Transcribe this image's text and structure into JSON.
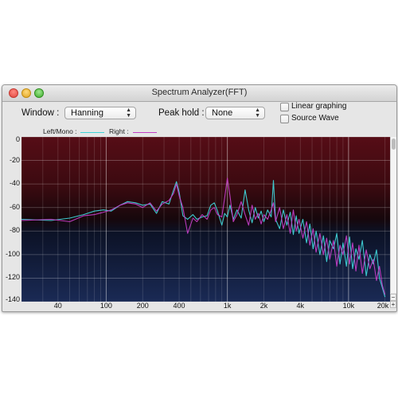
{
  "window": {
    "title": "Spectrum Analyzer(FFT)"
  },
  "controls": {
    "window_label": "Window :",
    "window_value": "Hanning",
    "peak_hold_label": "Peak hold :",
    "peak_hold_value": "None",
    "linear_graphing_label": "Linear graphing",
    "linear_graphing_checked": false,
    "source_wave_label": "Source Wave",
    "source_wave_checked": false
  },
  "legend": {
    "left_label": "Left/Mono :",
    "left_color": "#3fd3d8",
    "right_label": "Right :",
    "right_color": "#c23ec6"
  },
  "scroll": {
    "zoom_in": "+",
    "zoom_out": "−"
  },
  "chart_data": {
    "type": "line",
    "x_scale": "log",
    "xlim": [
      20,
      22000
    ],
    "ylim": [
      -140,
      0
    ],
    "grid": true,
    "x_tick_labels": [
      {
        "value": 40,
        "label": "40"
      },
      {
        "value": 100,
        "label": "100"
      },
      {
        "value": 200,
        "label": "200"
      },
      {
        "value": 400,
        "label": "400"
      },
      {
        "value": 1000,
        "label": "1k"
      },
      {
        "value": 2000,
        "label": "2k"
      },
      {
        "value": 4000,
        "label": "4k"
      },
      {
        "value": 10000,
        "label": "10k"
      },
      {
        "value": 20000,
        "label": "20k"
      }
    ],
    "y_tick_labels": [
      {
        "value": 0,
        "label": "0"
      },
      {
        "value": -20,
        "label": "-20"
      },
      {
        "value": -40,
        "label": "-40"
      },
      {
        "value": -60,
        "label": "-60"
      },
      {
        "value": -80,
        "label": "-80"
      },
      {
        "value": -100,
        "label": "-100"
      },
      {
        "value": -120,
        "label": "-120"
      },
      {
        "value": -140,
        "label": "-140"
      }
    ],
    "series": [
      {
        "name": "Left/Mono :",
        "color": "#3fd3d8",
        "points": [
          [
            20,
            -70
          ],
          [
            35,
            -71
          ],
          [
            50,
            -69
          ],
          [
            65,
            -66
          ],
          [
            80,
            -63
          ],
          [
            95,
            -62
          ],
          [
            110,
            -63
          ],
          [
            130,
            -58
          ],
          [
            150,
            -55
          ],
          [
            175,
            -56
          ],
          [
            200,
            -58
          ],
          [
            230,
            -57
          ],
          [
            260,
            -65
          ],
          [
            290,
            -55
          ],
          [
            330,
            -57
          ],
          [
            360,
            -45
          ],
          [
            380,
            -38
          ],
          [
            400,
            -47
          ],
          [
            430,
            -67
          ],
          [
            470,
            -70
          ],
          [
            520,
            -66
          ],
          [
            560,
            -70
          ],
          [
            620,
            -68
          ],
          [
            680,
            -67
          ],
          [
            730,
            -58
          ],
          [
            780,
            -56
          ],
          [
            830,
            -63
          ],
          [
            900,
            -75
          ],
          [
            950,
            -65
          ],
          [
            1000,
            -68
          ],
          [
            1050,
            -58
          ],
          [
            1120,
            -70
          ],
          [
            1200,
            -62
          ],
          [
            1300,
            -69
          ],
          [
            1400,
            -45
          ],
          [
            1500,
            -62
          ],
          [
            1600,
            -73
          ],
          [
            1700,
            -60
          ],
          [
            1800,
            -69
          ],
          [
            1900,
            -63
          ],
          [
            2000,
            -72
          ],
          [
            2150,
            -62
          ],
          [
            2300,
            -68
          ],
          [
            2400,
            -37
          ],
          [
            2500,
            -70
          ],
          [
            2700,
            -78
          ],
          [
            2900,
            -62
          ],
          [
            3100,
            -75
          ],
          [
            3300,
            -64
          ],
          [
            3500,
            -83
          ],
          [
            3700,
            -67
          ],
          [
            3900,
            -82
          ],
          [
            4200,
            -70
          ],
          [
            4500,
            -90
          ],
          [
            4800,
            -74
          ],
          [
            5100,
            -95
          ],
          [
            5400,
            -80
          ],
          [
            5800,
            -100
          ],
          [
            6200,
            -84
          ],
          [
            6600,
            -106
          ],
          [
            7000,
            -88
          ],
          [
            7500,
            -95
          ],
          [
            8000,
            -82
          ],
          [
            8500,
            -108
          ],
          [
            9000,
            -90
          ],
          [
            9600,
            -110
          ],
          [
            10200,
            -85
          ],
          [
            10800,
            -112
          ],
          [
            11500,
            -95
          ],
          [
            12200,
            -104
          ],
          [
            13000,
            -88
          ],
          [
            14000,
            -118
          ],
          [
            15000,
            -100
          ],
          [
            16000,
            -108
          ],
          [
            17000,
            -96
          ],
          [
            18000,
            -120
          ],
          [
            19000,
            -128
          ],
          [
            20000,
            -136
          ]
        ]
      },
      {
        "name": "Right :",
        "color": "#c23ec6",
        "points": [
          [
            20,
            -71
          ],
          [
            35,
            -70
          ],
          [
            50,
            -72
          ],
          [
            65,
            -67
          ],
          [
            80,
            -66
          ],
          [
            95,
            -64
          ],
          [
            110,
            -62
          ],
          [
            130,
            -58
          ],
          [
            150,
            -56
          ],
          [
            175,
            -57
          ],
          [
            200,
            -60
          ],
          [
            230,
            -56
          ],
          [
            260,
            -63
          ],
          [
            290,
            -57
          ],
          [
            330,
            -54
          ],
          [
            360,
            -48
          ],
          [
            380,
            -40
          ],
          [
            400,
            -50
          ],
          [
            430,
            -60
          ],
          [
            470,
            -82
          ],
          [
            520,
            -69
          ],
          [
            560,
            -72
          ],
          [
            620,
            -66
          ],
          [
            680,
            -70
          ],
          [
            730,
            -62
          ],
          [
            780,
            -60
          ],
          [
            830,
            -66
          ],
          [
            900,
            -68
          ],
          [
            950,
            -52
          ],
          [
            1000,
            -35
          ],
          [
            1050,
            -50
          ],
          [
            1120,
            -72
          ],
          [
            1200,
            -66
          ],
          [
            1300,
            -55
          ],
          [
            1400,
            -66
          ],
          [
            1500,
            -75
          ],
          [
            1600,
            -58
          ],
          [
            1700,
            -70
          ],
          [
            1800,
            -65
          ],
          [
            1900,
            -74
          ],
          [
            2000,
            -66
          ],
          [
            2150,
            -70
          ],
          [
            2300,
            -62
          ],
          [
            2400,
            -56
          ],
          [
            2500,
            -72
          ],
          [
            2700,
            -60
          ],
          [
            2900,
            -78
          ],
          [
            3100,
            -66
          ],
          [
            3300,
            -82
          ],
          [
            3500,
            -62
          ],
          [
            3700,
            -80
          ],
          [
            3900,
            -70
          ],
          [
            4200,
            -86
          ],
          [
            4500,
            -72
          ],
          [
            4800,
            -92
          ],
          [
            5100,
            -78
          ],
          [
            5400,
            -98
          ],
          [
            5800,
            -82
          ],
          [
            6200,
            -100
          ],
          [
            6600,
            -86
          ],
          [
            7000,
            -104
          ],
          [
            7500,
            -88
          ],
          [
            8000,
            -110
          ],
          [
            8500,
            -92
          ],
          [
            9000,
            -100
          ],
          [
            9600,
            -84
          ],
          [
            10200,
            -108
          ],
          [
            10800,
            -90
          ],
          [
            11500,
            -114
          ],
          [
            12200,
            -92
          ],
          [
            13000,
            -116
          ],
          [
            14000,
            -96
          ],
          [
            15000,
            -112
          ],
          [
            16000,
            -104
          ],
          [
            17000,
            -122
          ],
          [
            18000,
            -110
          ],
          [
            19000,
            -126
          ],
          [
            20000,
            -134
          ]
        ]
      }
    ]
  }
}
